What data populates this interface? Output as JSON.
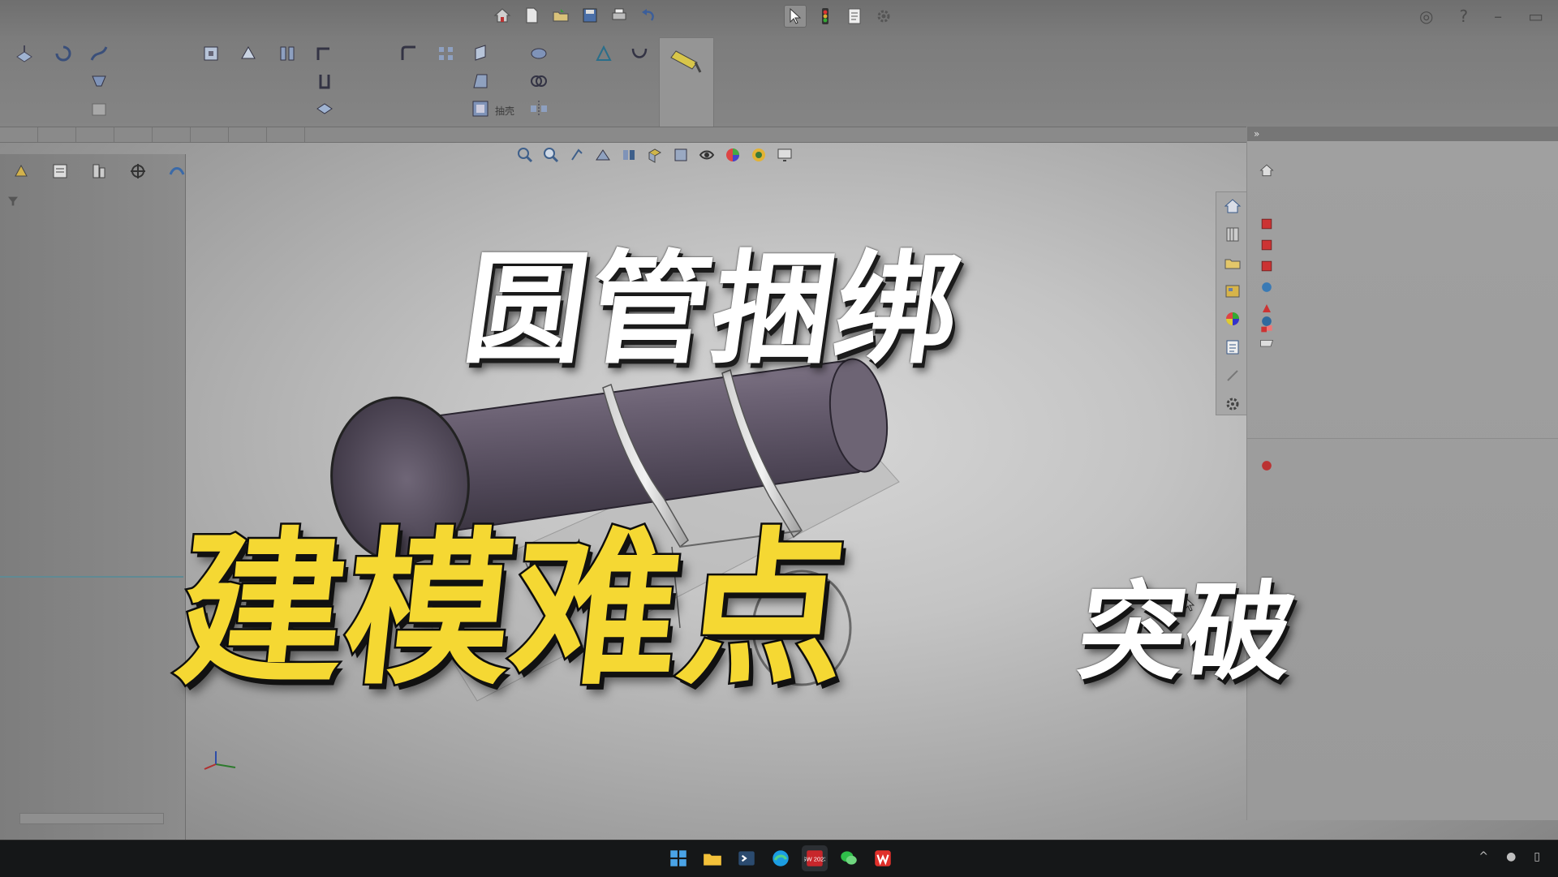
{
  "app": {
    "name": "SolidWorks",
    "taskbar_icon_text": "SW 2023"
  },
  "overlay": {
    "headline": "圆管捆绑",
    "subline": "建模难点",
    "tag": "突破"
  },
  "ribbon": {
    "shell_label": "抽壳"
  },
  "quick_access": {
    "icons": [
      "home-icon",
      "new-file-icon",
      "open-file-icon",
      "save-icon",
      "print-icon",
      "undo-icon",
      "select-pointer-icon",
      "rebuild-traffic-light-icon",
      "file-properties-icon",
      "options-gear-icon"
    ]
  },
  "task_pane": {
    "collapse_label": "»",
    "tabs": [
      "home-icon",
      "parts-library-icon",
      "file-explorer-icon",
      "view-palette-icon",
      "appearances-icon",
      "custom-properties-icon",
      "forum-icon",
      "settings-icon"
    ]
  },
  "taskbar": {
    "apps": [
      "windows-start-icon",
      "file-explorer-icon",
      "terminal-icon",
      "edge-icon",
      "solidworks-icon",
      "wechat-icon",
      "wps-icon"
    ]
  },
  "colors": {
    "accent_yellow": "#f5d833",
    "title_white": "#ffffff",
    "pipe_purple": "#5e5466",
    "taskbar_bg": "#151718"
  }
}
